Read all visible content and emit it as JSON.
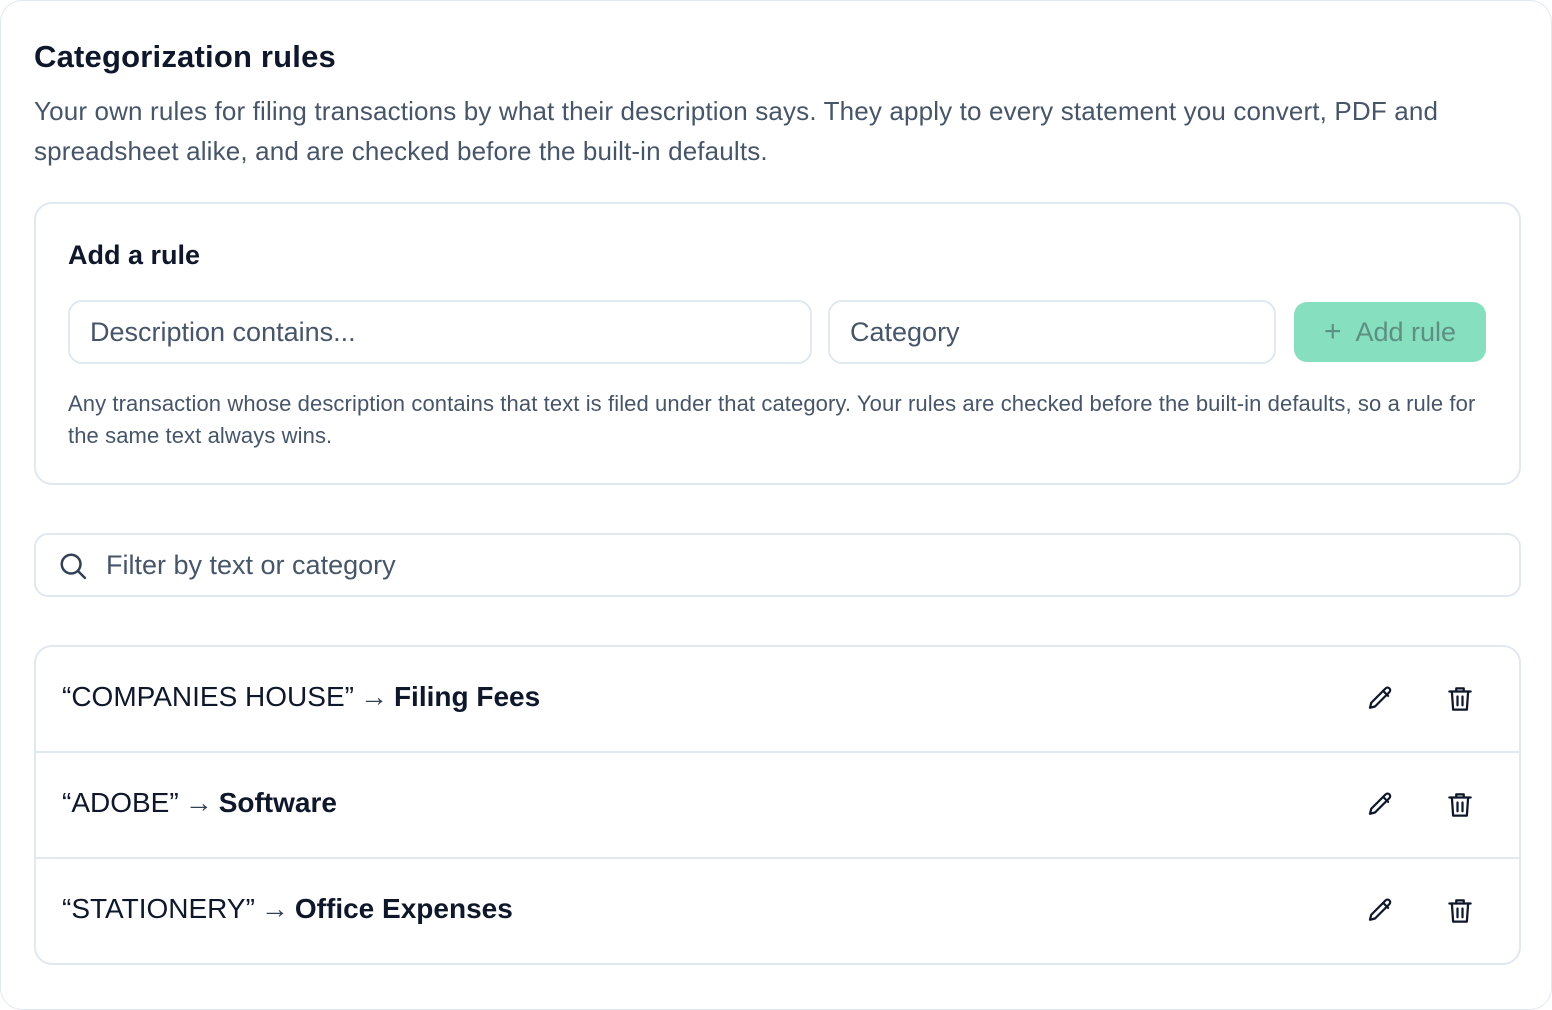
{
  "header": {
    "title": "Categorization rules",
    "subtitle": "Your own rules for filing transactions by what their description says. They apply to every statement you convert, PDF and spreadsheet alike, and are checked before the built-in defaults."
  },
  "add_rule": {
    "title": "Add a rule",
    "description_placeholder": "Description contains...",
    "category_placeholder": "Category",
    "button_label": "Add rule",
    "button_icon": "plus-icon",
    "hint": "Any transaction whose description contains that text is filed under that category. Your rules are checked before the built-in defaults, so a rule for the same text always wins."
  },
  "filter": {
    "placeholder": "Filter by text or category",
    "icon": "search-icon"
  },
  "rules": [
    {
      "match": "“COMPANIES HOUSE”",
      "arrow": "→",
      "category": "Filing Fees"
    },
    {
      "match": "“ADOBE”",
      "arrow": "→",
      "category": "Software"
    },
    {
      "match": "“STATIONERY”",
      "arrow": "→",
      "category": "Office Expenses"
    }
  ],
  "colors": {
    "accent_disabled": "#86dfbe",
    "border": "#e2e8f0",
    "muted_text": "#475569",
    "text": "#0f172a"
  }
}
